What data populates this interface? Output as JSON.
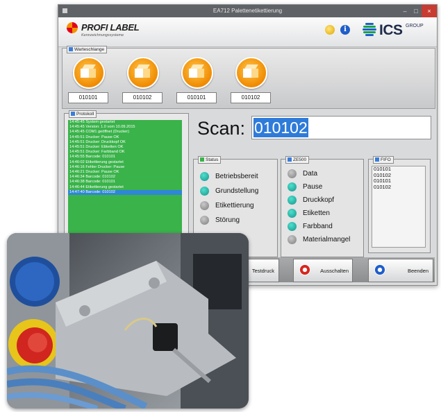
{
  "window": {
    "title": "EA712 Palettenetikettierung",
    "controls": [
      "–",
      "□",
      "×"
    ]
  },
  "header": {
    "brand": "PROFI LABEL",
    "tagline": "Kennzeichnungssysteme",
    "partner_logo": "ICS",
    "partner_group": "GROUP",
    "icons": [
      "moon-icon",
      "info-icon"
    ]
  },
  "queue": {
    "label": "Warteschlange",
    "items": [
      "010101",
      "010102",
      "010101",
      "010102"
    ]
  },
  "protocol": {
    "label": "Protokoll",
    "lines": [
      "14:45:45 System gestartet",
      "14:45:45 Version: 1.0 vom 10.09.2015",
      "14:45:45 COM1 geöffnet (Drucker)",
      "14:45:51 Drucker: Pause OK",
      "14:45:51 Drucker: Druckkopf OK",
      "14:45:51 Drucker: Etiketten OK",
      "14:45:51 Drucker: Farbband OK",
      "14:45:55 Barcode: 010101",
      "14:46:02 Etikettierung gestartet",
      "14:46:16 Fehler Drucker: Pause",
      "14:46:21 Drucker: Pause OK",
      "14:46:34 Barcode: 010102",
      "14:46:38 Barcode: 010101",
      "14:46:44 Etikettierung gestartet",
      "14:47:40 Barcode: 010102"
    ],
    "selected_index": 14
  },
  "scan": {
    "label": "Scan:",
    "value": "010102"
  },
  "status": {
    "label": "Status",
    "items": [
      {
        "label": "Betriebsbereit",
        "state": "teal"
      },
      {
        "label": "Grundstellung",
        "state": "teal"
      },
      {
        "label": "Etikettierung",
        "state": "grey"
      },
      {
        "label": "Störung",
        "state": "grey"
      }
    ]
  },
  "ze500": {
    "label": "ZE500",
    "items": [
      {
        "label": "Data",
        "state": "grey"
      },
      {
        "label": "Pause",
        "state": "teal"
      },
      {
        "label": "Druckkopf",
        "state": "teal"
      },
      {
        "label": "Etiketten",
        "state": "teal"
      },
      {
        "label": "Farbband",
        "state": "teal"
      },
      {
        "label": "Materialmangel",
        "state": "grey"
      }
    ]
  },
  "fifo": {
    "label": "FIFO",
    "items": [
      "010101",
      "010102",
      "010101",
      "010102"
    ]
  },
  "buttons": {
    "testdruck": "Testdruck",
    "ausschalten": "Ausschalten",
    "beenden": "Beenden"
  },
  "colors": {
    "log_background": "#3ab34a",
    "selection": "#2f86d6",
    "led_on": "#14948a",
    "led_off": "#7d7d7d",
    "queue_accent": "#f08a00",
    "close_button": "#c73b31"
  }
}
